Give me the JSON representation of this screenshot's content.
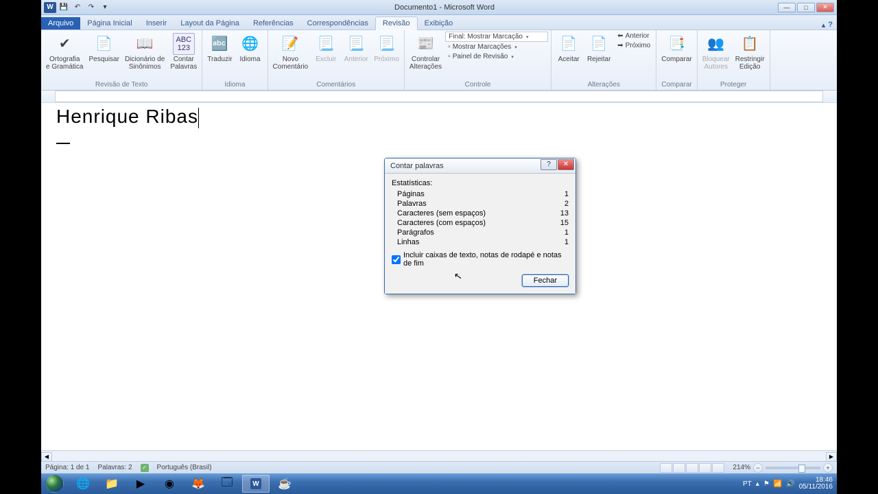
{
  "window": {
    "title": "Documento1 - Microsoft Word"
  },
  "tabs": {
    "file": "Arquivo",
    "items": [
      "Página Inicial",
      "Inserir",
      "Layout da Página",
      "Referências",
      "Correspondências",
      "Revisão",
      "Exibição"
    ],
    "active_index": 5
  },
  "ribbon": {
    "groups": {
      "revisao_texto": {
        "label": "Revisão de Texto",
        "ortografia": "Ortografia\ne Gramática",
        "pesquisar": "Pesquisar",
        "dicionario": "Dicionário de\nSinônimos",
        "contar": "Contar\nPalavras"
      },
      "idioma": {
        "label": "Idioma",
        "traduzir": "Traduzir",
        "idioma": "Idioma"
      },
      "comentarios": {
        "label": "Comentários",
        "novo": "Novo\nComentário",
        "excluir": "Excluir",
        "anterior": "Anterior",
        "proximo": "Próximo"
      },
      "controle": {
        "label": "Controle",
        "controlar": "Controlar\nAlterações",
        "final": "Final: Mostrar Marcação",
        "mostrar": "Mostrar Marcações",
        "painel": "Painel de Revisão"
      },
      "alteracoes": {
        "label": "Alterações",
        "aceitar": "Aceitar",
        "rejeitar": "Rejeitar",
        "anterior": "Anterior",
        "proximo": "Próximo"
      },
      "comparar": {
        "label": "Comparar",
        "comparar": "Comparar"
      },
      "proteger": {
        "label": "Proteger",
        "bloquear": "Bloquear\nAutores",
        "restringir": "Restringir\nEdição"
      }
    }
  },
  "document": {
    "heading": "Henrique  Ribas"
  },
  "dialog": {
    "title": "Contar palavras",
    "stats_label": "Estatísticas:",
    "rows": [
      {
        "k": "Páginas",
        "v": "1"
      },
      {
        "k": "Palavras",
        "v": "2"
      },
      {
        "k": "Caracteres (sem espaços)",
        "v": "13"
      },
      {
        "k": "Caracteres (com espaços)",
        "v": "15"
      },
      {
        "k": "Parágrafos",
        "v": "1"
      },
      {
        "k": "Linhas",
        "v": "1"
      }
    ],
    "checkbox": "Incluir caixas de texto, notas de rodapé e notas de fim",
    "close": "Fechar"
  },
  "status": {
    "page": "Página: 1 de 1",
    "words": "Palavras: 2",
    "lang": "Português (Brasil)",
    "zoom": "214%"
  },
  "tray": {
    "lang": "PT",
    "time": "18:46",
    "date": "05/11/2016"
  }
}
